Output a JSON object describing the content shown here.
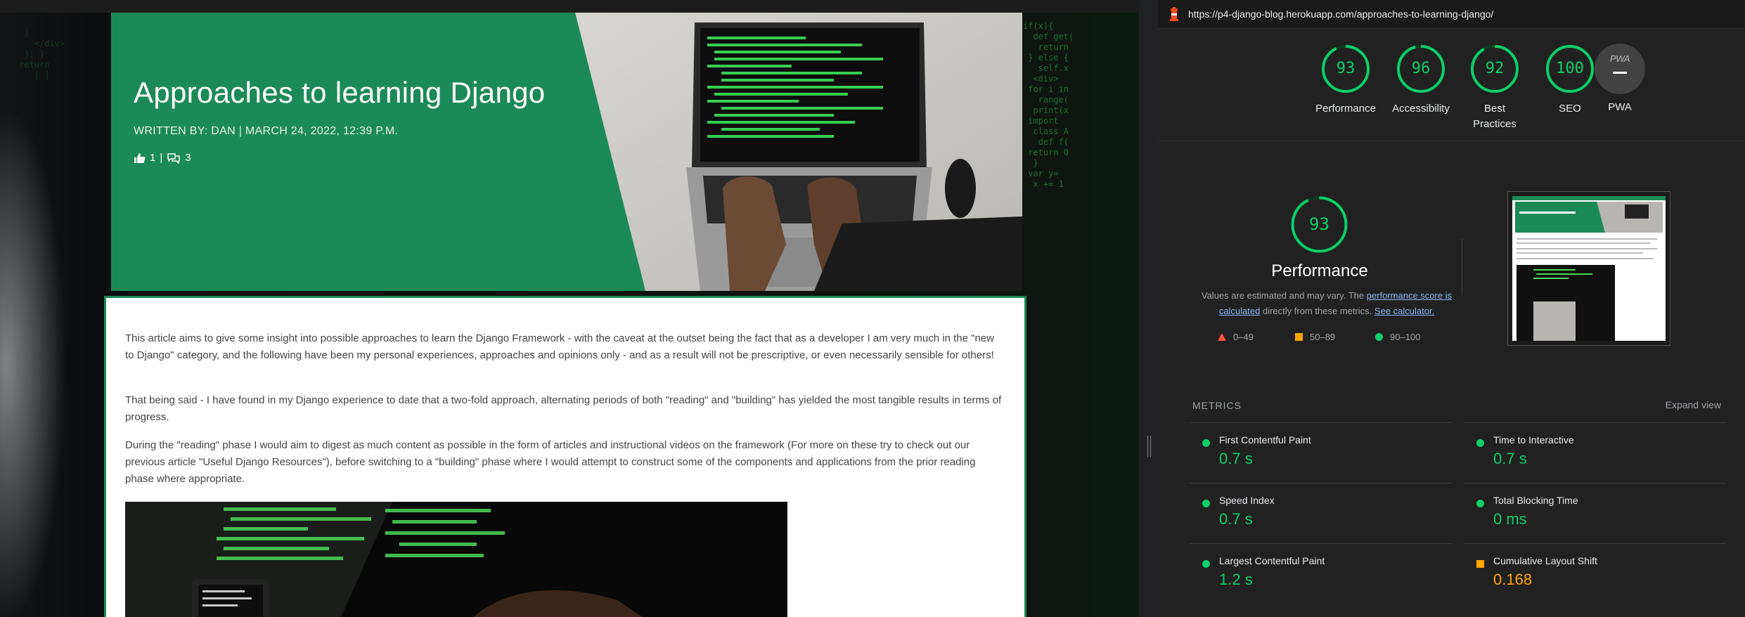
{
  "blog": {
    "title": "Approaches to learning Django",
    "byline": "WRITTEN BY: DAN | MARCH 24, 2022, 12:39 P.M.",
    "likes": "1",
    "separator": "|",
    "comments": "3",
    "paragraphs": [
      "This article aims to give some insight into possible approaches to learn the Django Framework - with the caveat at the outset being the fact that as a developer I am very much in the \"new to Django\" category, and the following have been my personal experiences, approaches and opinions only - and as a result will not be prescriptive, or even necessarily sensible for others!",
      "That being said - I have found in my Django experience to date that a two-fold approach, alternating periods of both \"reading\" and \"building\" has yielded the most tangible results in terms of progress.",
      "During the \"reading\" phase I would aim to digest as much content as possible in the form of articles and instructional videos on the framework (For more on these try to check out our previous article \"Useful Django Resources\"), before switching to a \"building\" phase where I would attempt to construct some of the components and applications from the prior reading phase where appropriate."
    ]
  },
  "lighthouse": {
    "url": "https://p4-django-blog.herokuapp.com/approaches-to-learning-django/",
    "scores": [
      {
        "label": "Performance",
        "value": "93",
        "score": 93
      },
      {
        "label": "Accessibility",
        "value": "96",
        "score": 96
      },
      {
        "label": "Best Practices",
        "value": "92",
        "score": 92
      },
      {
        "label": "SEO",
        "value": "100",
        "score": 100
      }
    ],
    "pwa": {
      "badge": "PWA",
      "label": "PWA"
    },
    "performance": {
      "score": "93",
      "title": "Performance",
      "note_prefix": "Values are estimated and may vary. The ",
      "note_link1": "performance score is calculated",
      "note_middle": " directly from these metrics. ",
      "note_link2": "See calculator."
    },
    "legend": {
      "fail": "0–49",
      "average": "50–89",
      "pass": "90–100"
    },
    "metrics_heading": "METRICS",
    "expand_label": "Expand view",
    "metrics": [
      {
        "name": "First Contentful Paint",
        "value": "0.7 s",
        "status": "pass"
      },
      {
        "name": "Time to Interactive",
        "value": "0.7 s",
        "status": "pass"
      },
      {
        "name": "Speed Index",
        "value": "0.7 s",
        "status": "pass"
      },
      {
        "name": "Total Blocking Time",
        "value": "0 ms",
        "status": "pass"
      },
      {
        "name": "Largest Contentful Paint",
        "value": "1.2 s",
        "status": "pass"
      },
      {
        "name": "Cumulative Layout Shift",
        "value": "0.168",
        "status": "average"
      }
    ]
  },
  "colors": {
    "brand_green": "#1c8a58",
    "pass": "#0cce6b",
    "average": "#ffa400",
    "fail": "#ff4e42",
    "panel_bg": "#212121"
  }
}
